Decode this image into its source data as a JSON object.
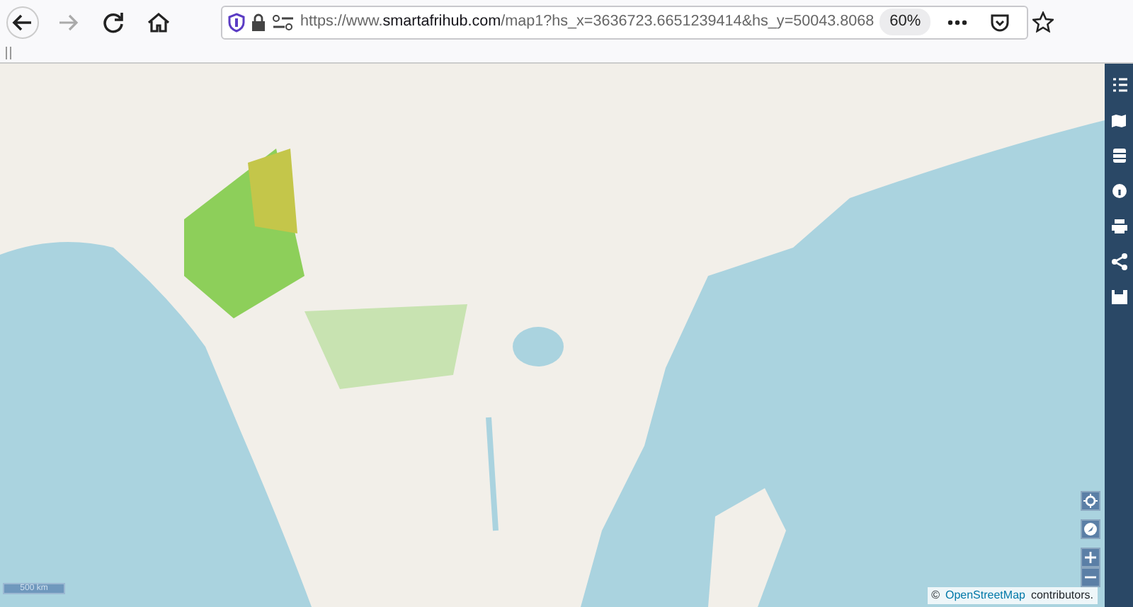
{
  "toolbar": {
    "url": "https://www.**smartafrihub.com**/map1?hs_x=3636723.6651239414&hs_y=50043.8068",
    "zoom": "60%"
  },
  "map": {
    "scale_label": "500 km",
    "attribution": {
      "symbol": "©",
      "link": "OpenStreetMap",
      "text": "contributors."
    }
  }
}
